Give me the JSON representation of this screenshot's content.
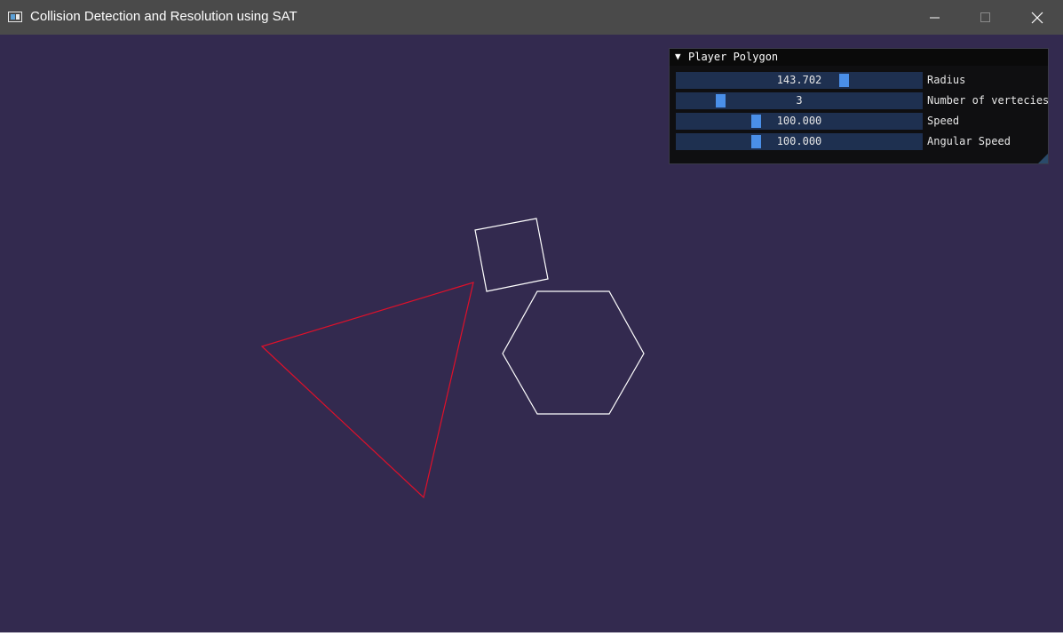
{
  "window": {
    "title": "Collision Detection and Resolution using SAT",
    "app_icon": "app-window-icon",
    "controls": [
      "minimize-icon",
      "maximize-icon",
      "close-icon"
    ]
  },
  "panel": {
    "title": "Player Polygon",
    "collapse_icon": "triangle-down-icon",
    "sliders": [
      {
        "label": "Radius",
        "value": "143.702",
        "fraction": 0.69
      },
      {
        "label": "Number of vertecies",
        "value": "3",
        "fraction": 0.17
      },
      {
        "label": "Speed",
        "value": "100.000",
        "fraction": 0.32
      },
      {
        "label": "Angular Speed",
        "value": "100.000",
        "fraction": 0.32
      }
    ]
  },
  "scene": {
    "background": "#332a4f",
    "player_polygon": {
      "vertices": 3,
      "color": "#e0102a"
    },
    "obstacles": [
      {
        "shape": "square",
        "vertices": 4,
        "color": "#ffffff"
      },
      {
        "shape": "hexagon",
        "vertices": 6,
        "color": "#ffffff"
      }
    ]
  }
}
